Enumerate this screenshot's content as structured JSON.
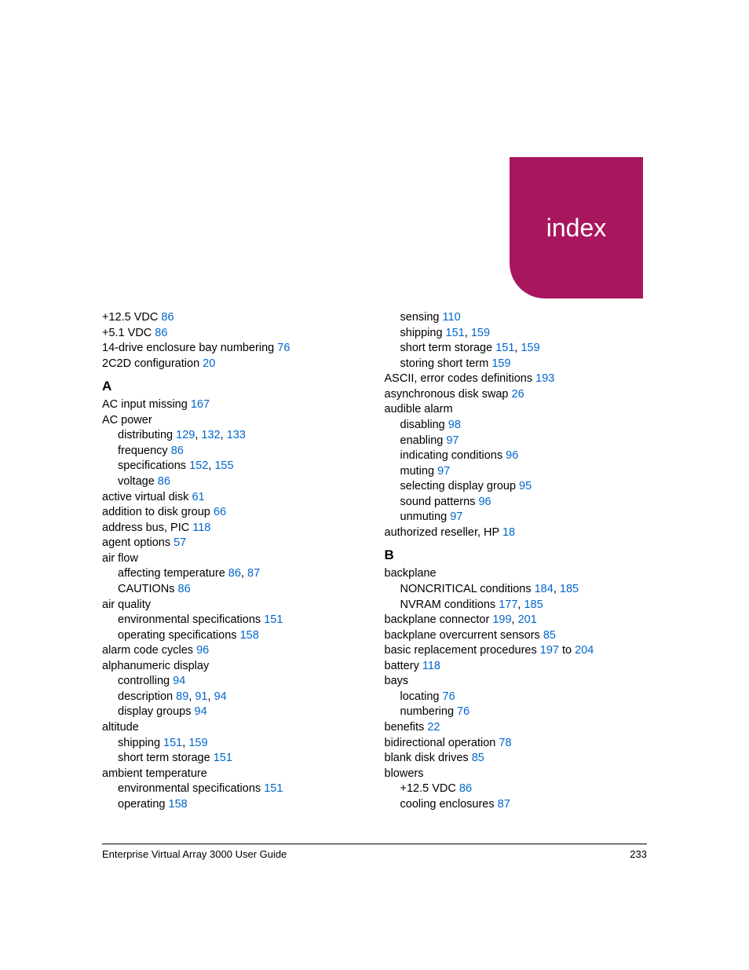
{
  "header": {
    "tab_label": "index"
  },
  "footer": {
    "title": "Enterprise Virtual Array 3000 User Guide",
    "page": "233"
  },
  "left": {
    "pre": [
      {
        "text": "+12.5 VDC ",
        "refs": [
          "86"
        ]
      },
      {
        "text": "+5.1 VDC ",
        "refs": [
          "86"
        ]
      },
      {
        "text": "14-drive enclosure bay numbering ",
        "refs": [
          "76"
        ]
      },
      {
        "text": "2C2D configuration ",
        "refs": [
          "20"
        ]
      }
    ],
    "A": [
      {
        "text": "AC input missing ",
        "refs": [
          "167"
        ]
      },
      {
        "text": "AC power"
      },
      {
        "text": "distributing ",
        "refs": [
          "129",
          "132",
          "133"
        ],
        "sub": true
      },
      {
        "text": "frequency ",
        "refs": [
          "86"
        ],
        "sub": true
      },
      {
        "text": "specifications ",
        "refs": [
          "152",
          "155"
        ],
        "sub": true
      },
      {
        "text": "voltage ",
        "refs": [
          "86"
        ],
        "sub": true
      },
      {
        "text": "active virtual disk ",
        "refs": [
          "61"
        ]
      },
      {
        "text": "addition to disk group ",
        "refs": [
          "66"
        ]
      },
      {
        "text": "address bus, PIC ",
        "refs": [
          "118"
        ]
      },
      {
        "text": "agent options ",
        "refs": [
          "57"
        ]
      },
      {
        "text": "air flow"
      },
      {
        "text": "affecting temperature ",
        "refs": [
          "86",
          "87"
        ],
        "sub": true
      },
      {
        "text": "CAUTIONs ",
        "refs": [
          "86"
        ],
        "sub": true
      },
      {
        "text": "air quality"
      },
      {
        "text": "environmental specifications ",
        "refs": [
          "151"
        ],
        "sub": true
      },
      {
        "text": "operating specifications ",
        "refs": [
          "158"
        ],
        "sub": true
      },
      {
        "text": "alarm code cycles ",
        "refs": [
          "96"
        ]
      },
      {
        "text": "alphanumeric display"
      },
      {
        "text": "controlling ",
        "refs": [
          "94"
        ],
        "sub": true
      },
      {
        "text": "description ",
        "refs": [
          "89",
          "91",
          "94"
        ],
        "sub": true
      },
      {
        "text": "display groups ",
        "refs": [
          "94"
        ],
        "sub": true
      },
      {
        "text": "altitude"
      },
      {
        "text": "shipping ",
        "refs": [
          "151",
          "159"
        ],
        "sub": true
      },
      {
        "text": "short term storage ",
        "refs": [
          "151"
        ],
        "sub": true
      },
      {
        "text": "ambient temperature"
      },
      {
        "text": "environmental specifications ",
        "refs": [
          "151"
        ],
        "sub": true
      },
      {
        "text": "operating ",
        "refs": [
          "158"
        ],
        "sub": true
      }
    ]
  },
  "right": {
    "cont": [
      {
        "text": "sensing ",
        "refs": [
          "110"
        ],
        "sub": true
      },
      {
        "text": "shipping ",
        "refs": [
          "151",
          "159"
        ],
        "sub": true
      },
      {
        "text": "short term storage ",
        "refs": [
          "151",
          "159"
        ],
        "sub": true
      },
      {
        "text": "storing short term ",
        "refs": [
          "159"
        ],
        "sub": true
      },
      {
        "text": "ASCII, error codes definitions ",
        "refs": [
          "193"
        ]
      },
      {
        "text": "asynchronous disk swap ",
        "refs": [
          "26"
        ]
      },
      {
        "text": "audible alarm"
      },
      {
        "text": "disabling ",
        "refs": [
          "98"
        ],
        "sub": true
      },
      {
        "text": "enabling ",
        "refs": [
          "97"
        ],
        "sub": true
      },
      {
        "text": "indicating conditions ",
        "refs": [
          "96"
        ],
        "sub": true
      },
      {
        "text": "muting ",
        "refs": [
          "97"
        ],
        "sub": true
      },
      {
        "text": "selecting display group ",
        "refs": [
          "95"
        ],
        "sub": true
      },
      {
        "text": "sound patterns ",
        "refs": [
          "96"
        ],
        "sub": true
      },
      {
        "text": "unmuting ",
        "refs": [
          "97"
        ],
        "sub": true
      },
      {
        "text": "authorized reseller, HP ",
        "refs": [
          "18"
        ]
      }
    ],
    "B": [
      {
        "text": "backplane"
      },
      {
        "text": "NONCRITICAL conditions ",
        "refs": [
          "184",
          "185"
        ],
        "sub": true
      },
      {
        "text": "NVRAM conditions ",
        "refs": [
          "177",
          "185"
        ],
        "sub": true
      },
      {
        "text": "backplane connector ",
        "refs": [
          "199",
          "201"
        ]
      },
      {
        "text": "backplane overcurrent sensors ",
        "refs": [
          "85"
        ]
      },
      {
        "text": "basic replacement procedures ",
        "refs": [
          "197"
        ],
        "to": "204"
      },
      {
        "text": "battery ",
        "refs": [
          "118"
        ]
      },
      {
        "text": "bays"
      },
      {
        "text": "locating ",
        "refs": [
          "76"
        ],
        "sub": true
      },
      {
        "text": "numbering ",
        "refs": [
          "76"
        ],
        "sub": true
      },
      {
        "text": "benefits ",
        "refs": [
          "22"
        ]
      },
      {
        "text": "bidirectional operation ",
        "refs": [
          "78"
        ]
      },
      {
        "text": "blank disk drives ",
        "refs": [
          "85"
        ]
      },
      {
        "text": "blowers"
      },
      {
        "text": "+12.5 VDC ",
        "refs": [
          "86"
        ],
        "sub": true
      },
      {
        "text": "cooling enclosures ",
        "refs": [
          "87"
        ],
        "sub": true
      }
    ]
  },
  "letters": {
    "A": "A",
    "B": "B"
  },
  "to_word": " to "
}
